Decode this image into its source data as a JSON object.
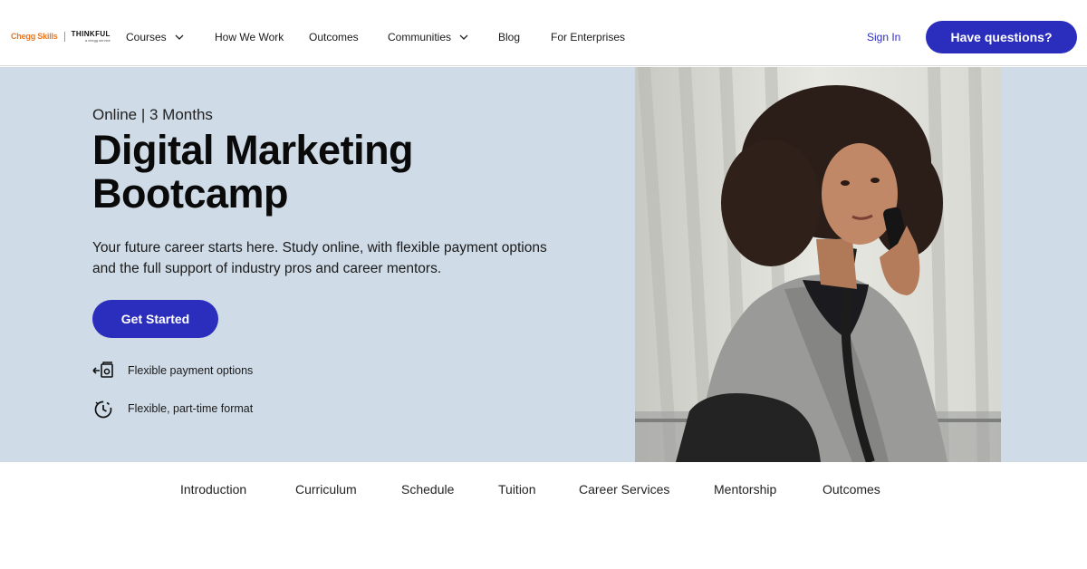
{
  "logo": {
    "chegg": "Chegg Skills",
    "thinkful": "THINKFUL",
    "thinkful_sub": "a chegg service"
  },
  "nav": {
    "courses": "Courses",
    "how_we_work": "How We Work",
    "outcomes": "Outcomes",
    "communities": "Communities",
    "blog": "Blog",
    "for_enterprises": "For Enterprises",
    "sign_in": "Sign In",
    "cta": "Have questions?"
  },
  "hero": {
    "meta": "Online | 3 Months",
    "title_line1": "Digital Marketing",
    "title_line2": "Bootcamp",
    "desc_line1": "Your future career starts here. Study online, with flexible payment options",
    "desc_line2": "and the full support of industry pros and career mentors.",
    "button": "Get Started",
    "features": [
      {
        "icon": "payment-icon",
        "label": "Flexible payment options"
      },
      {
        "icon": "clock-icon",
        "label": "Flexible, part-time format"
      }
    ]
  },
  "tabs": [
    "Introduction",
    "Curriculum",
    "Schedule",
    "Tuition",
    "Career Services",
    "Mentorship",
    "Outcomes"
  ],
  "colors": {
    "brand": "#2b2ebd",
    "hero_bg": "#cfdbe7",
    "chegg_orange": "#e87722"
  }
}
